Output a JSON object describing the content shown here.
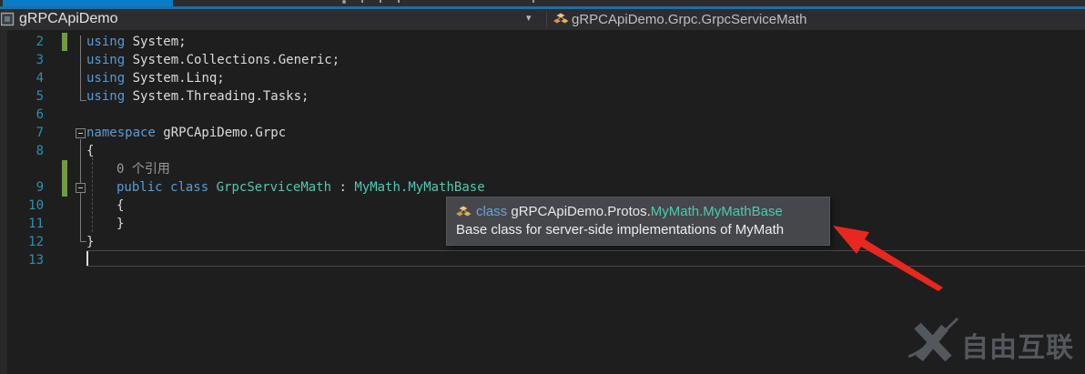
{
  "colors": {
    "accent_blue": "#0C7BC6",
    "keyword": "#569CD6",
    "type_name": "#4EC9B0",
    "line_number": "#2B91AF",
    "plain_text": "#DCDCDC",
    "change_bar_green": "#6F9B45",
    "editor_background": "#1E1E1E",
    "navbar_background": "#2D2D30",
    "tooltip_background": "#45474B",
    "arrow_red": "#E8281E"
  },
  "icons": {
    "dropdown_chevron": "▾"
  },
  "navbar": {
    "project_dropdown": {
      "label": "gRPCApiDemo"
    },
    "type_dropdown": {
      "label": "gRPCApiDemo.Grpc.GrpcServiceMath"
    }
  },
  "editor": {
    "lines": [
      {
        "num": "2",
        "indent": 0,
        "changed": true,
        "segments": [
          {
            "text": "using",
            "kind": "keyword"
          },
          {
            "text": " System;",
            "kind": "plain"
          }
        ]
      },
      {
        "num": "3",
        "indent": 0,
        "segments": [
          {
            "text": "using",
            "kind": "keyword"
          },
          {
            "text": " System.Collections.Generic;",
            "kind": "plain"
          }
        ]
      },
      {
        "num": "4",
        "indent": 0,
        "segments": [
          {
            "text": "using",
            "kind": "keyword"
          },
          {
            "text": " System.Linq;",
            "kind": "plain"
          }
        ]
      },
      {
        "num": "5",
        "indent": 0,
        "segments": [
          {
            "text": "using",
            "kind": "keyword"
          },
          {
            "text": " System.Threading.Tasks;",
            "kind": "plain"
          }
        ]
      },
      {
        "num": "6",
        "indent": 0,
        "segments": []
      },
      {
        "num": "7",
        "indent": 0,
        "segments": [
          {
            "text": "namespace",
            "kind": "keyword"
          },
          {
            "text": " gRPCApiDemo.Grpc",
            "kind": "plain"
          }
        ]
      },
      {
        "num": "8",
        "indent": 0,
        "segments": [
          {
            "text": "{",
            "kind": "plain"
          }
        ]
      },
      {
        "num": "",
        "indent": 1,
        "changed": true,
        "codelens": true,
        "segments": [
          {
            "text": "0 个引用",
            "kind": "codelens"
          }
        ]
      },
      {
        "num": "9",
        "indent": 1,
        "changed": true,
        "segments": [
          {
            "text": "public",
            "kind": "keyword"
          },
          {
            "text": " ",
            "kind": "plain"
          },
          {
            "text": "class",
            "kind": "keyword"
          },
          {
            "text": " ",
            "kind": "plain"
          },
          {
            "text": "GrpcServiceMath",
            "kind": "type"
          },
          {
            "text": " : ",
            "kind": "plain"
          },
          {
            "text": "MyMath.MyMathBase",
            "kind": "type"
          }
        ]
      },
      {
        "num": "10",
        "indent": 1,
        "segments": [
          {
            "text": "{",
            "kind": "plain"
          }
        ]
      },
      {
        "num": "11",
        "indent": 1,
        "segments": [
          {
            "text": "}",
            "kind": "plain"
          }
        ]
      },
      {
        "num": "12",
        "indent": 0,
        "segments": [
          {
            "text": "}",
            "kind": "plain"
          }
        ]
      },
      {
        "num": "13",
        "indent": 0,
        "caret": true,
        "segments": []
      }
    ]
  },
  "tooltip": {
    "kind": "class",
    "qualifier": "gRPCApiDemo.Protos.",
    "type_name": "MyMath.MyMathBase",
    "description": "Base class for server-side implementations of MyMath"
  },
  "watermark": {
    "text": "自由互联"
  }
}
